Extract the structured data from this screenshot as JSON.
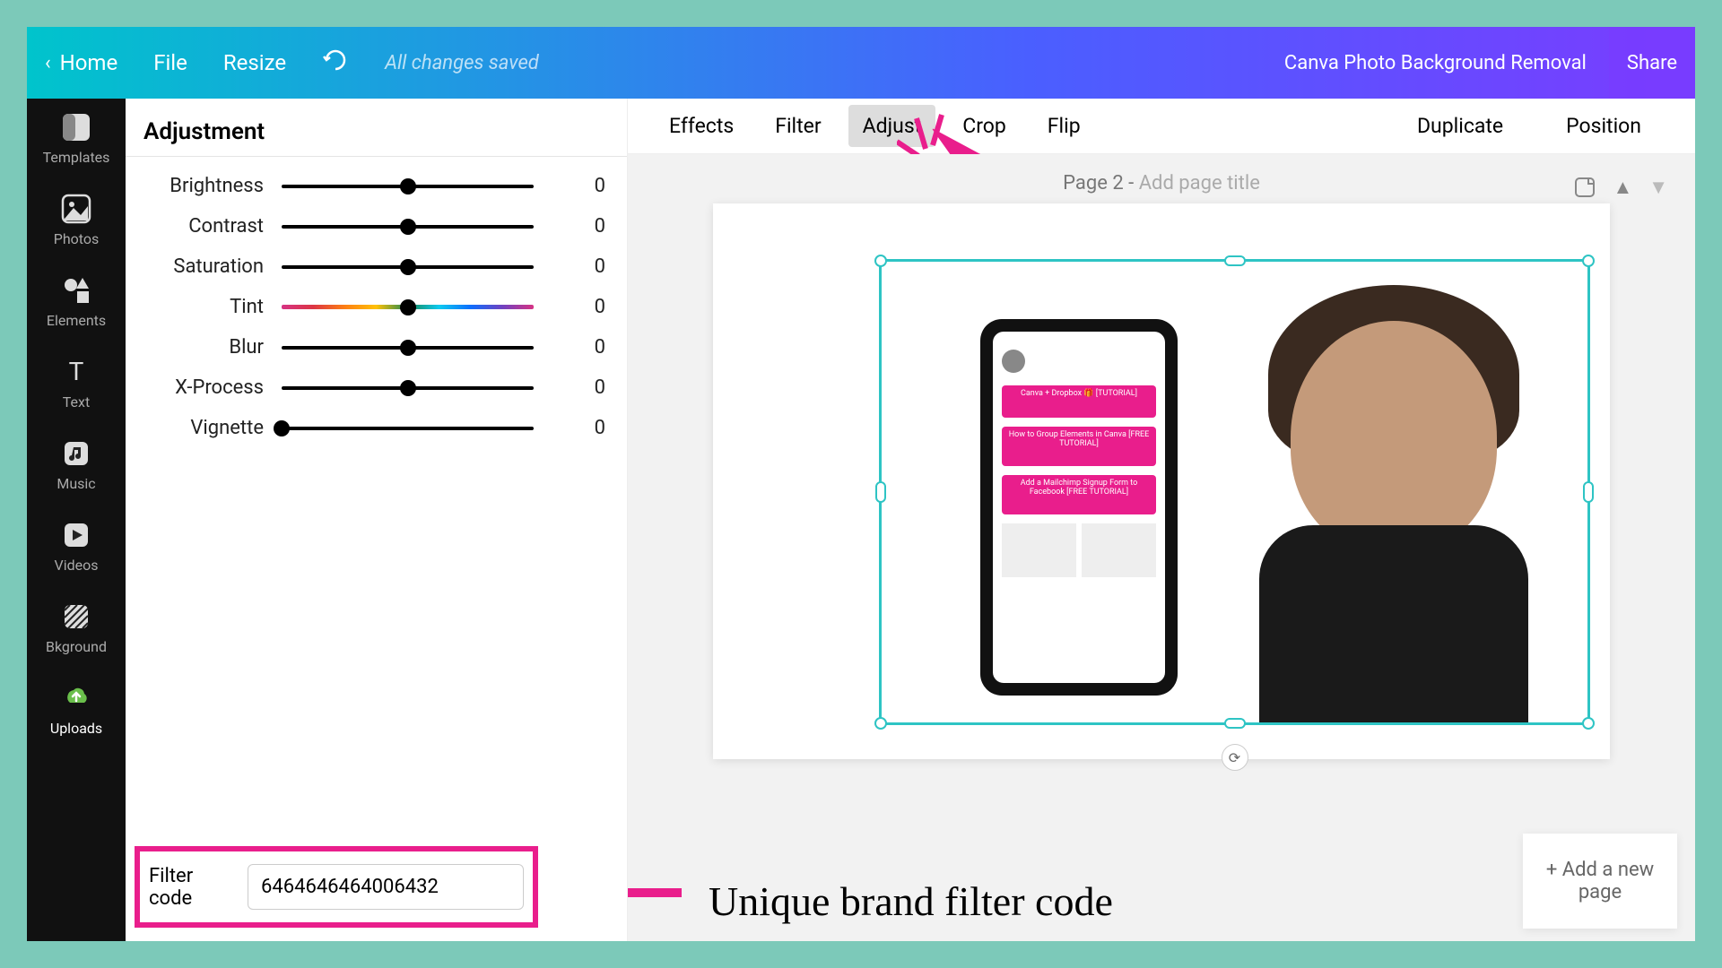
{
  "colors": {
    "accent": "#e91e8c",
    "selection": "#2ec4c4"
  },
  "top_bar": {
    "home": "Home",
    "file": "File",
    "resize": "Resize",
    "saved_status": "All changes saved",
    "document_title": "Canva Photo Background Removal",
    "share": "Share"
  },
  "left_rail": [
    {
      "id": "templates",
      "label": "Templates",
      "icon": "templates-icon"
    },
    {
      "id": "photos",
      "label": "Photos",
      "icon": "photos-icon"
    },
    {
      "id": "elements",
      "label": "Elements",
      "icon": "elements-icon"
    },
    {
      "id": "text",
      "label": "Text",
      "icon": "text-icon"
    },
    {
      "id": "music",
      "label": "Music",
      "icon": "music-icon"
    },
    {
      "id": "videos",
      "label": "Videos",
      "icon": "videos-icon"
    },
    {
      "id": "bkground",
      "label": "Bkground",
      "icon": "background-icon"
    },
    {
      "id": "uploads",
      "label": "Uploads",
      "icon": "uploads-icon",
      "active": true
    }
  ],
  "adjust_panel": {
    "title": "Adjustment",
    "sliders": [
      {
        "label": "Brightness",
        "value": 0,
        "pos": 50
      },
      {
        "label": "Contrast",
        "value": 0,
        "pos": 50
      },
      {
        "label": "Saturation",
        "value": 0,
        "pos": 50
      },
      {
        "label": "Tint",
        "value": 0,
        "pos": 50,
        "rainbow": true
      },
      {
        "label": "Blur",
        "value": 0,
        "pos": 50
      },
      {
        "label": "X-Process",
        "value": 0,
        "pos": 50
      },
      {
        "label": "Vignette",
        "value": 0,
        "pos": 0
      }
    ],
    "filter_code_label": "Filter code",
    "filter_code_value": "6464646464006432"
  },
  "tool_strip": {
    "tabs": [
      "Effects",
      "Filter",
      "Adjust",
      "Crop",
      "Flip"
    ],
    "active_tab": "Adjust",
    "right": [
      "Duplicate",
      "Position"
    ]
  },
  "canvas": {
    "page_prefix": "Page 2 - ",
    "page_hint": "Add page title",
    "add_page": "+ Add a new page",
    "phone_items": [
      "Canva + Dropbox 🎁 [TUTORIAL]",
      "How to Group Elements in Canva [FREE TUTORIAL]",
      "Add a Mailchimp Signup Form to Facebook [FREE TUTORIAL]"
    ]
  },
  "annotations": {
    "filter_code_note": "Unique brand filter code"
  }
}
